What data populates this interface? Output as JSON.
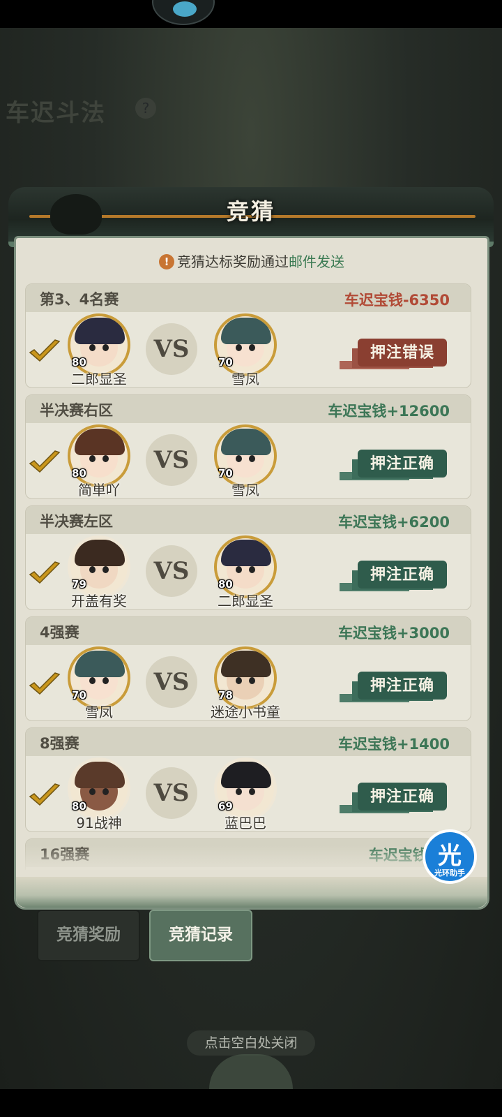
{
  "background": {
    "title": "车迟斗法",
    "help_icon": "?"
  },
  "panel": {
    "title": "竞猜",
    "notice_prefix": "竞猜达标奖励通过",
    "notice_link": "邮件发送",
    "notice_icon": "!"
  },
  "matches": [
    {
      "round": "第3、4名赛",
      "reward": "车迟宝钱-6350",
      "result": "lose",
      "stamp": "押注错误",
      "left": {
        "name": "二郎显圣",
        "level": "80",
        "skin": "#f4dcc8",
        "hair": "#2a2b40",
        "frame": "gold"
      },
      "right": {
        "name": "雪凤",
        "level": "70",
        "skin": "#f7e1d0",
        "hair": "#3b5a5a",
        "frame": "gold"
      }
    },
    {
      "round": "半决赛右区",
      "reward": "车迟宝钱+12600",
      "result": "win",
      "stamp": "押注正确",
      "left": {
        "name": "简単吖",
        "level": "80",
        "skin": "#f7dfcc",
        "hair": "#5a3424",
        "frame": "gold"
      },
      "right": {
        "name": "雪凤",
        "level": "70",
        "skin": "#f7e1d0",
        "hair": "#3b5a5a",
        "frame": "gold"
      }
    },
    {
      "round": "半决赛左区",
      "reward": "车迟宝钱+6200",
      "result": "win",
      "stamp": "押注正确",
      "left": {
        "name": "开盖有奖",
        "level": "79",
        "skin": "#f0d8c2",
        "hair": "#3b2a20",
        "frame": "plain"
      },
      "right": {
        "name": "二郎显圣",
        "level": "80",
        "skin": "#f4dcc8",
        "hair": "#2a2b40",
        "frame": "gold"
      }
    },
    {
      "round": "4强赛",
      "reward": "车迟宝钱+3000",
      "result": "win",
      "stamp": "押注正确",
      "left": {
        "name": "雪凤",
        "level": "70",
        "skin": "#f7e1d0",
        "hair": "#3b5a5a",
        "frame": "gold"
      },
      "right": {
        "name": "迷途小书童",
        "level": "78",
        "skin": "#ead0b6",
        "hair": "#3e3024",
        "frame": "gold"
      }
    },
    {
      "round": "8强赛",
      "reward": "车迟宝钱+1400",
      "result": "win",
      "stamp": "押注正确",
      "left": {
        "name": "91战神",
        "level": "80",
        "skin": "#8a5a44",
        "hair": "#5a3a2a",
        "frame": "plain"
      },
      "right": {
        "name": "蓝巴巴",
        "level": "69",
        "skin": "#f4e0d0",
        "hair": "#1e1e22",
        "frame": "plain"
      }
    },
    {
      "round": "16强赛",
      "reward": "车迟宝钱+6",
      "result": "win",
      "stamp": "",
      "left": null,
      "right": null
    }
  ],
  "tabs": {
    "rewards": "竞猜奖励",
    "records": "竞猜记录",
    "active": "records"
  },
  "close_hint": "点击空白处关闭",
  "helper_badge": {
    "char": "光",
    "label": "光环助手"
  },
  "colors": {
    "win": "#3c7656",
    "lose": "#b14a36",
    "stamp_ok": "#2f5c4c",
    "stamp_bad": "#8a3f31",
    "check": "#c9961c"
  }
}
